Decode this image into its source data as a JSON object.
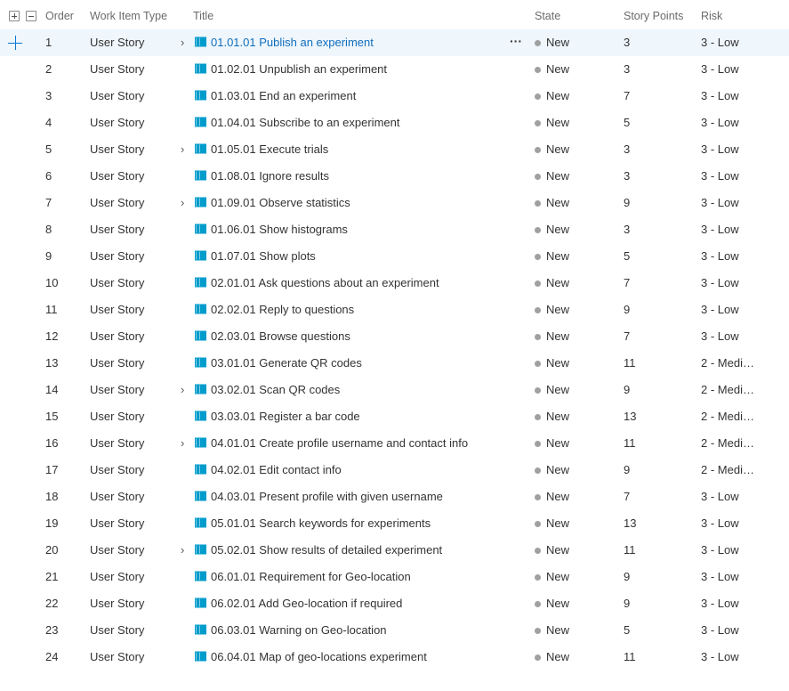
{
  "header": {
    "order": "Order",
    "work_item_type": "Work Item Type",
    "title": "Title",
    "state": "State",
    "story_points": "Story Points",
    "risk": "Risk"
  },
  "icons": {
    "expand_all": "expand-all-icon",
    "collapse_all": "collapse-all-icon",
    "add": "plus-icon",
    "chevron": "chevron-right-icon",
    "story": "book-icon",
    "more": "more-actions-icon",
    "state_dot": "state-dot-icon"
  },
  "colors": {
    "selected_row_bg": "#eff6fc",
    "selected_title": "#106ebe",
    "story_icon": "#009ccc",
    "state_new": "#a0a0a0",
    "accent": "#0078d4"
  },
  "rows": [
    {
      "order": "1",
      "type": "User Story",
      "has_children": true,
      "title": "01.01.01 Publish an experiment",
      "state": "New",
      "points": "3",
      "risk": "3 - Low",
      "selected": true
    },
    {
      "order": "2",
      "type": "User Story",
      "has_children": false,
      "title": "01.02.01 Unpublish an experiment",
      "state": "New",
      "points": "3",
      "risk": "3 - Low"
    },
    {
      "order": "3",
      "type": "User Story",
      "has_children": false,
      "title": "01.03.01 End an experiment",
      "state": "New",
      "points": "7",
      "risk": "3 - Low"
    },
    {
      "order": "4",
      "type": "User Story",
      "has_children": false,
      "title": "01.04.01 Subscribe to an experiment",
      "state": "New",
      "points": "5",
      "risk": "3 - Low"
    },
    {
      "order": "5",
      "type": "User Story",
      "has_children": true,
      "title": "01.05.01 Execute trials",
      "state": "New",
      "points": "3",
      "risk": "3 - Low"
    },
    {
      "order": "6",
      "type": "User Story",
      "has_children": false,
      "title": "01.08.01 Ignore results",
      "state": "New",
      "points": "3",
      "risk": "3 - Low"
    },
    {
      "order": "7",
      "type": "User Story",
      "has_children": true,
      "title": "01.09.01 Observe statistics",
      "state": "New",
      "points": "9",
      "risk": "3 - Low"
    },
    {
      "order": "8",
      "type": "User Story",
      "has_children": false,
      "title": "01.06.01 Show histograms",
      "state": "New",
      "points": "3",
      "risk": "3 - Low"
    },
    {
      "order": "9",
      "type": "User Story",
      "has_children": false,
      "title": "01.07.01 Show plots",
      "state": "New",
      "points": "5",
      "risk": "3 - Low"
    },
    {
      "order": "10",
      "type": "User Story",
      "has_children": false,
      "title": "02.01.01 Ask questions about an experiment",
      "state": "New",
      "points": "7",
      "risk": "3 - Low"
    },
    {
      "order": "11",
      "type": "User Story",
      "has_children": false,
      "title": "02.02.01 Reply to questions",
      "state": "New",
      "points": "9",
      "risk": "3 - Low"
    },
    {
      "order": "12",
      "type": "User Story",
      "has_children": false,
      "title": "02.03.01 Browse questions",
      "state": "New",
      "points": "7",
      "risk": "3 - Low"
    },
    {
      "order": "13",
      "type": "User Story",
      "has_children": false,
      "title": "03.01.01 Generate QR codes",
      "state": "New",
      "points": "11",
      "risk": "2 - Medi…"
    },
    {
      "order": "14",
      "type": "User Story",
      "has_children": true,
      "title": "03.02.01 Scan QR codes",
      "state": "New",
      "points": "9",
      "risk": "2 - Medi…"
    },
    {
      "order": "15",
      "type": "User Story",
      "has_children": false,
      "title": "03.03.01 Register a bar code",
      "state": "New",
      "points": "13",
      "risk": "2 - Medi…"
    },
    {
      "order": "16",
      "type": "User Story",
      "has_children": true,
      "title": "04.01.01 Create profile username and contact info",
      "state": "New",
      "points": "11",
      "risk": "2 - Medi…"
    },
    {
      "order": "17",
      "type": "User Story",
      "has_children": false,
      "title": "04.02.01 Edit contact info",
      "state": "New",
      "points": "9",
      "risk": "2 - Medi…"
    },
    {
      "order": "18",
      "type": "User Story",
      "has_children": false,
      "title": "04.03.01 Present profile with given username",
      "state": "New",
      "points": "7",
      "risk": "3 - Low"
    },
    {
      "order": "19",
      "type": "User Story",
      "has_children": false,
      "title": "05.01.01 Search keywords for experiments",
      "state": "New",
      "points": "13",
      "risk": "3 - Low"
    },
    {
      "order": "20",
      "type": "User Story",
      "has_children": true,
      "title": "05.02.01 Show results of detailed experiment",
      "state": "New",
      "points": "11",
      "risk": "3 - Low"
    },
    {
      "order": "21",
      "type": "User Story",
      "has_children": false,
      "title": "06.01.01 Requirement for Geo-location",
      "state": "New",
      "points": "9",
      "risk": "3 - Low"
    },
    {
      "order": "22",
      "type": "User Story",
      "has_children": false,
      "title": "06.02.01 Add Geo-location if required",
      "state": "New",
      "points": "9",
      "risk": "3 - Low"
    },
    {
      "order": "23",
      "type": "User Story",
      "has_children": false,
      "title": "06.03.01 Warning on Geo-location",
      "state": "New",
      "points": "5",
      "risk": "3 - Low"
    },
    {
      "order": "24",
      "type": "User Story",
      "has_children": false,
      "title": "06.04.01 Map of geo-locations experiment",
      "state": "New",
      "points": "11",
      "risk": "3 - Low"
    }
  ]
}
